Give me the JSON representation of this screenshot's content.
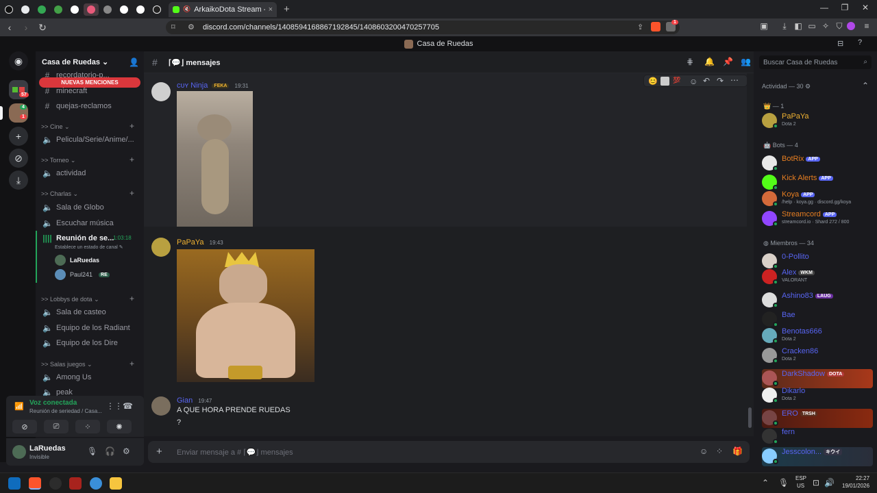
{
  "browser": {
    "active_tab_title": "ArkaikoDota Stream - Watch Live",
    "url": "discord.com/channels/1408594168867192845/1408603200470257705",
    "window_title": "Casa de Ruedas",
    "notification_count": "1"
  },
  "rail": {
    "badge_57": "57",
    "badge_1": "1",
    "badge_4": "4"
  },
  "sidebar": {
    "server_name": "Casa de Ruedas",
    "new_mentions": "NUEVAS MENCIONES",
    "channels": {
      "recordatorio": "recordatorio-p...",
      "minecraft": "minecraft",
      "quejas": "quejas-reclamos",
      "cat_cine": ">> Cine",
      "pelicula": "Pelicula/Serie/Anime/...",
      "cat_torneo": ">> Torneo",
      "actividad": "actividad",
      "cat_charlas": ">> Charlas",
      "sala_globo": "Sala de Globo",
      "escuchar": "Escuchar música",
      "reunion": "Reunión de se...",
      "reunion_time": "1:03:18",
      "reunion_status": "Establece un estado de canal",
      "voice_user1": "LaRuedas",
      "voice_user2": "Paul241",
      "voice_user2_tag": "RE",
      "cat_lobbys": ">> Lobbys de dota",
      "sala_casteo": "Sala de casteo",
      "radiant": "Equipo de los Radiant",
      "dire": "Equipo de los Dire",
      "cat_salas": ">> Salas juegos",
      "among": "Among Us",
      "peak": "peak"
    },
    "voice": {
      "status": "Voz conectada",
      "detail": "Reunión de seriedad / Casa..."
    },
    "user": {
      "name": "LaRuedas",
      "status": "Invisible"
    }
  },
  "chat": {
    "channel_name": "mensajes",
    "messages": [
      {
        "author": "ᴄᴜʏ Ninja",
        "tag": "FEKA",
        "time": "19:31"
      },
      {
        "author": "PaPaYa",
        "time": "19:43"
      },
      {
        "author": "Gian",
        "time": "19:47",
        "line1": "A QUE HORA PRENDE RUEDAS",
        "line2": "?"
      }
    ],
    "composer_placeholder": "Enviar mensaje a # ⌈💬⌋ mensajes"
  },
  "members": {
    "search_placeholder": "Buscar Casa de Ruedas",
    "activity_header": "Actividad — 30",
    "cat_1": "— 1",
    "cat_bots": "Bots — 4",
    "cat_miembros": "Miembros — 34",
    "list": [
      {
        "name": "PaPaYa",
        "sub": "Dota 2",
        "color": "#f0b232"
      },
      {
        "name": "BotRix",
        "tag": "APP",
        "color": "#e67e22"
      },
      {
        "name": "Kick Alerts",
        "tag": "APP",
        "color": "#e67e22"
      },
      {
        "name": "Koya",
        "tag": "APP",
        "sub": "/help · koya.gg · discord.gg/koya",
        "color": "#e67e22"
      },
      {
        "name": "Streamcord",
        "tag": "APP",
        "sub": "streamcord.io · Shard 272 / 800",
        "color": "#e67e22"
      },
      {
        "name": "0-Pollito",
        "color": "#5865f2"
      },
      {
        "name": "Alex",
        "tag": "WKM",
        "sub": "VALORANT",
        "color": "#5865f2"
      },
      {
        "name": "Ashino83",
        "tag": "LAUG",
        "color": "#5865f2"
      },
      {
        "name": "Bae",
        "color": "#5865f2"
      },
      {
        "name": "Benotas666",
        "sub": "Dota 2",
        "color": "#5865f2"
      },
      {
        "name": "Cracken86",
        "sub": "Dota 2",
        "color": "#5865f2"
      },
      {
        "name": "DarkShadow",
        "tag": "DOTA",
        "color": "#5865f2"
      },
      {
        "name": "Dikarlo",
        "sub": "Dota 2",
        "color": "#5865f2"
      },
      {
        "name": "ERO",
        "tag": "TRSH",
        "color": "#5865f2"
      },
      {
        "name": "fern",
        "color": "#5865f2"
      },
      {
        "name": "Jesscolon...",
        "tag": "キウイ",
        "color": "#5865f2"
      }
    ]
  },
  "taskbar": {
    "lang1": "ESP",
    "lang2": "US",
    "time": "22:27",
    "date": "19/01/2026"
  }
}
